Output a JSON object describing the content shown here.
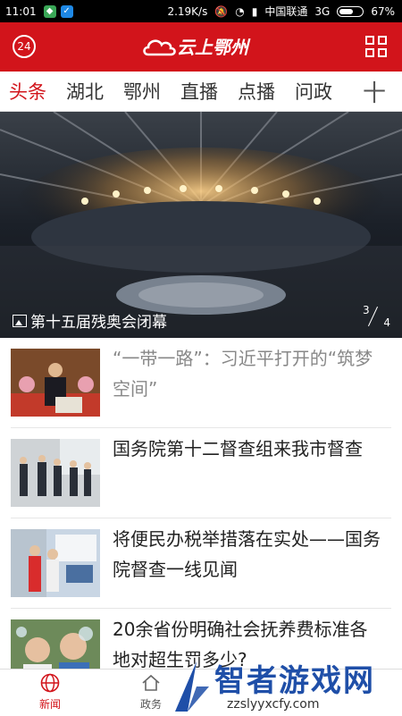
{
  "status_bar": {
    "time": "11:01",
    "speed": "2.19K/s",
    "carrier": "中国联通",
    "network": "3G",
    "battery": "67%",
    "battery_level": 0.67
  },
  "header": {
    "badge": "24",
    "title": "云上鄂州"
  },
  "tabs": [
    "头条",
    "湖北",
    "鄂州",
    "直播",
    "点播",
    "问政"
  ],
  "tabs_more": "十",
  "hero": {
    "caption": "第十五届残奥会闭幕",
    "page_current": "3",
    "page_total": "4"
  },
  "news": [
    {
      "title": "“一带一路”：习近平打开的“筑梦空间”",
      "read": true
    },
    {
      "title": "国务院第十二督查组来我市督查",
      "read": false
    },
    {
      "title": "将便民办税举措落在实处——国务院督查一线见闻",
      "read": false
    },
    {
      "title": "20余省份明确社会抚养费标准各地对超生罚多少?",
      "read": false
    }
  ],
  "bottom_tabs": [
    {
      "label": "新闻",
      "active": true
    },
    {
      "label": "政务",
      "active": false
    }
  ],
  "watermark": {
    "title": "智者游戏网",
    "url": "zzslyyxcfy.com"
  },
  "colors": {
    "brand_red": "#d2141b",
    "status_bar": "#000000"
  }
}
